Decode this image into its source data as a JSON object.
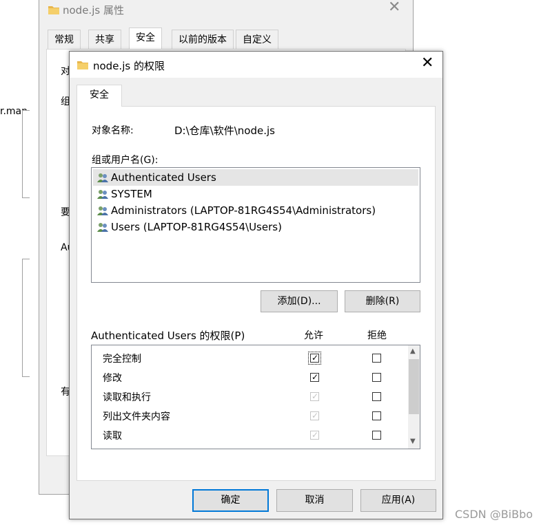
{
  "desktop": {
    "label": "r.man",
    "watermark": "CSDN @BiBbo"
  },
  "background_window": {
    "title": "node.js 属性",
    "close_label": "✕",
    "tabs": [
      "常规",
      "共享",
      "安全",
      "以前的版本",
      "自定义"
    ],
    "fragments": [
      "对",
      "组",
      "要",
      "Au",
      "有"
    ]
  },
  "dialog": {
    "title": "node.js 的权限",
    "close_label": "✕",
    "tab": "安全",
    "object_name_label": "对象名称:",
    "object_name_value": "D:\\仓库\\软件\\node.js",
    "group_label": "组或用户名(G):",
    "users": [
      "Authenticated Users",
      "SYSTEM",
      "Administrators (LAPTOP-81RG4S54\\Administrators)",
      "Users (LAPTOP-81RG4S54\\Users)"
    ],
    "selected_user_index": 0,
    "add_button": "添加(D)...",
    "remove_button": "删除(R)",
    "perm_header": "Authenticated Users 的权限(P)",
    "allow_header": "允许",
    "deny_header": "拒绝",
    "permissions": [
      {
        "name": "完全控制",
        "allow": true,
        "allow_disabled": false,
        "deny": false
      },
      {
        "name": "修改",
        "allow": true,
        "allow_disabled": false,
        "deny": false
      },
      {
        "name": "读取和执行",
        "allow": true,
        "allow_disabled": true,
        "deny": false
      },
      {
        "name": "列出文件夹内容",
        "allow": true,
        "allow_disabled": true,
        "deny": false
      },
      {
        "name": "读取",
        "allow": true,
        "allow_disabled": true,
        "deny": false
      }
    ],
    "ok_button": "确定",
    "cancel_button": "取消",
    "apply_button": "应用(A)"
  },
  "colors": {
    "accent": "#0078d7",
    "folder": "#e8b64c",
    "window_bg": "#f0f0f0"
  }
}
